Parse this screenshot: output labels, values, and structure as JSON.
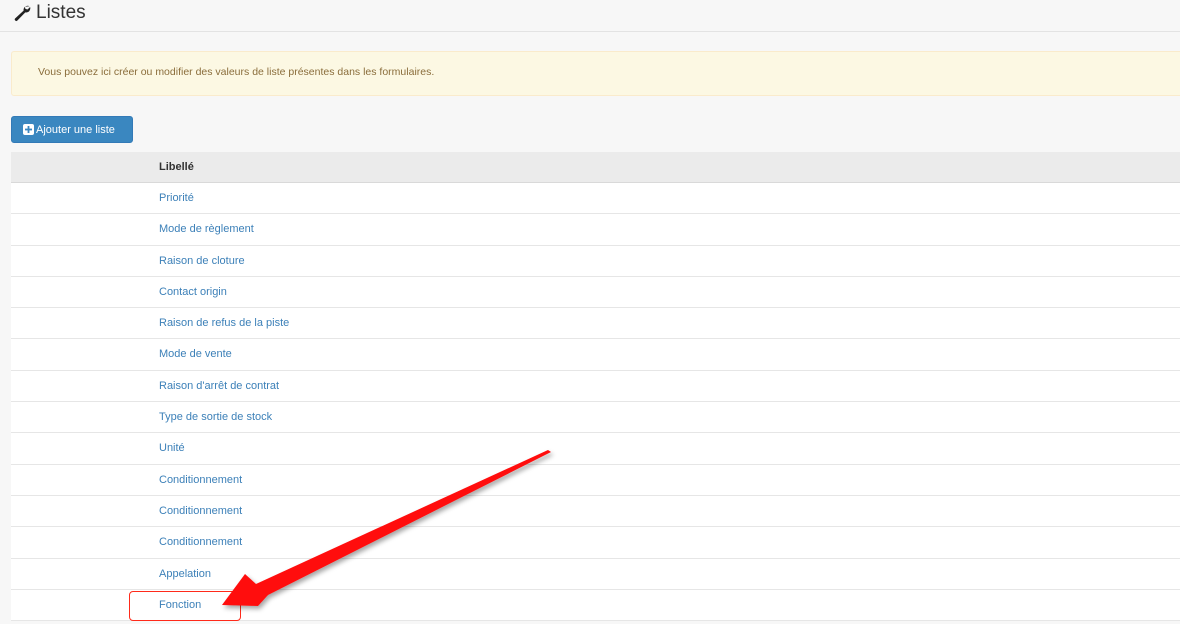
{
  "page": {
    "title": "Listes",
    "title_icon": "wrench-icon"
  },
  "alert": {
    "text": "Vous pouvez ici créer ou modifier des valeurs de liste présentes dans les formulaires."
  },
  "toolbar": {
    "add_label": "Ajouter une liste",
    "add_icon": "plus-square-icon"
  },
  "table": {
    "column_header": "Libellé",
    "rows": [
      "Priorité",
      "Mode de règlement",
      "Raison de cloture",
      "Contact origin",
      "Raison de refus de la piste",
      "Mode de vente",
      "Raison d'arrêt de contrat",
      "Type de sortie de stock",
      "Unité",
      "Conditionnement",
      "Conditionnement",
      "Conditionnement",
      "Appelation",
      "Fonction"
    ]
  },
  "annotation": {
    "highlighted_row": "Fonction",
    "color": "#ff0000"
  },
  "colors": {
    "alert_bg": "#fcf8e3",
    "button_bg": "#3a87c0",
    "link": "#3c80b8"
  }
}
